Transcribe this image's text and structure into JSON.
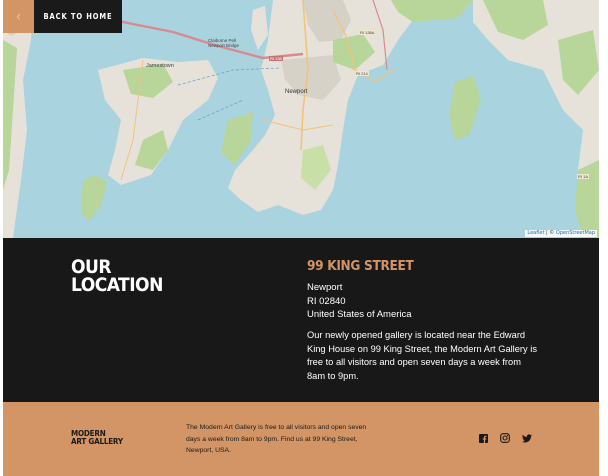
{
  "nav": {
    "back_label": "BACK TO HOME",
    "back_icon": "chevron-left-icon"
  },
  "map": {
    "labels": {
      "jamestown": "Jamestown",
      "bridge": "Claiborne Pell Newport Bridge",
      "newport": "Newport",
      "ri138": "RI 138",
      "ri138a": "RI 138A",
      "ri214": "RI 214",
      "ri1a": "RI 1A"
    },
    "attribution_leaflet": "Leaflet",
    "attribution_sep": " | © ",
    "attribution_osm": "OpenStreetMap",
    "colors": {
      "water": "#a9d3df",
      "land": "#e6e2da",
      "green": "#b8d59a",
      "road": "#d98a8f"
    }
  },
  "location": {
    "title_line1": "OUR",
    "title_line2": "LOCATION",
    "street": "99 KING STREET",
    "city": "Newport",
    "state_zip": "RI 02840",
    "country": "United States of America",
    "description": "Our newly opened gallery is located near the Edward King House on 99 King Street, the Modern Art Gallery is free to all visitors and open seven days a week from 8am to 9pm."
  },
  "footer": {
    "logo_line1": "MODERN",
    "logo_line2": "ART GALLERY",
    "text": "The Modern Art Gallery is free to all visitors and open seven days a week from 8am to 9pm. Find us at 99 King Street, Newport, USA.",
    "social": [
      "facebook-icon",
      "instagram-icon",
      "twitter-icon"
    ]
  },
  "colors": {
    "accent": "#d39565",
    "dark": "#181818",
    "white": "#ffffff"
  }
}
